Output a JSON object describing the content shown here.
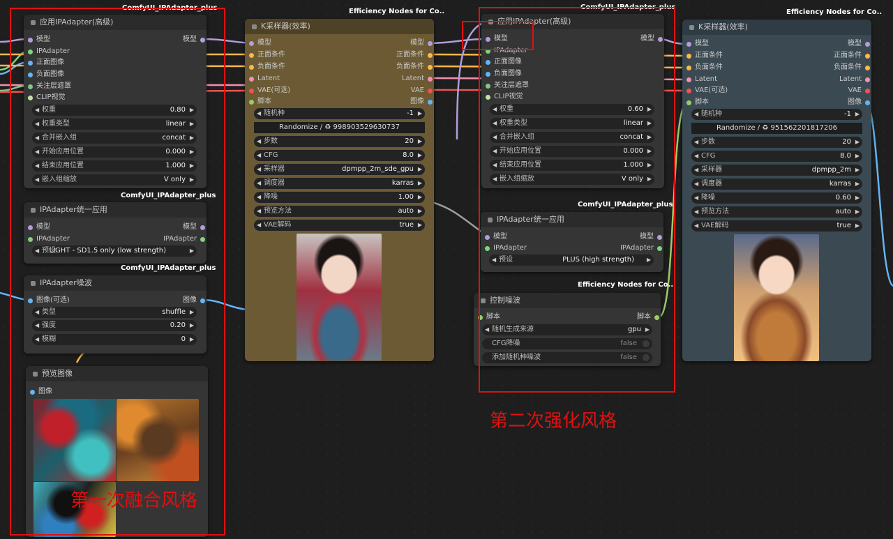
{
  "colors": {
    "model": "#b39ddb",
    "ipadapter": "#7cd67c",
    "image": "#64b5f6",
    "cond": "#ffb74d",
    "latent": "#f48fb1",
    "vae": "#ef5350",
    "mask": "#81c784",
    "clip": "#ffd54f",
    "script": "#9ccc65"
  },
  "n1": {
    "badge": "ComfyUI_IPAdapter_plus",
    "title": "应用IPAdapter(高级)",
    "inputs": [
      "模型",
      "IPAdapter",
      "正面图像",
      "负面图像",
      "关注层遮罩",
      "CLIP视觉"
    ],
    "out": "模型",
    "widgets": [
      {
        "label": "权重",
        "value": "0.80"
      },
      {
        "label": "权重类型",
        "value": "linear"
      },
      {
        "label": "合并嵌入组",
        "value": "concat"
      },
      {
        "label": "开始应用位置",
        "value": "0.000"
      },
      {
        "label": "结束应用位置",
        "value": "1.000"
      },
      {
        "label": "嵌入组缩放",
        "value": "V only"
      }
    ]
  },
  "n2": {
    "badge": "ComfyUI_IPAdapter_plus",
    "title": "IPAdapter统一应用",
    "inputs": [
      "模型",
      "IPAdapter"
    ],
    "outputs": [
      "模型",
      "IPAdapter"
    ],
    "widget": {
      "label": "预设",
      "value": "LIGHT - SD1.5 only (low strength)"
    }
  },
  "n3": {
    "badge": "ComfyUI_IPAdapter_plus",
    "title": "IPAdapter噪波",
    "input": "图像(可选)",
    "out": "图像",
    "widgets": [
      {
        "label": "类型",
        "value": "shuffle"
      },
      {
        "label": "强度",
        "value": "0.20"
      },
      {
        "label": "模糊",
        "value": "0"
      }
    ]
  },
  "n4": {
    "title": "预览图像",
    "input": "图像"
  },
  "n5": {
    "badge": "Efficiency Nodes for Co..",
    "title": "K采样器(效率)",
    "inputs": [
      "模型",
      "正面条件",
      "负面条件",
      "Latent",
      "VAE(可选)",
      "脚本"
    ],
    "outputs": [
      "模型",
      "正面条件",
      "负面条件",
      "Latent",
      "VAE",
      "图像"
    ],
    "seed": {
      "label": "随机种",
      "value": "-1"
    },
    "randomize": "Randomize / ♻ 998903529630737",
    "widgets": [
      {
        "label": "步数",
        "value": "20"
      },
      {
        "label": "CFG",
        "value": "8.0"
      },
      {
        "label": "采样器",
        "value": "dpmpp_2m_sde_gpu"
      },
      {
        "label": "调度器",
        "value": "karras"
      },
      {
        "label": "降噪",
        "value": "1.00"
      },
      {
        "label": "预览方法",
        "value": "auto"
      },
      {
        "label": "VAE解码",
        "value": "true"
      }
    ]
  },
  "n6": {
    "badge": "ComfyUI_IPAdapter_plus",
    "title": "应用IPAdapter(高级)",
    "inputs": [
      "模型",
      "IPAdapter",
      "正面图像",
      "负面图像",
      "关注层遮罩",
      "CLIP视觉"
    ],
    "out": "模型",
    "widgets": [
      {
        "label": "权重",
        "value": "0.60"
      },
      {
        "label": "权重类型",
        "value": "linear"
      },
      {
        "label": "合并嵌入组",
        "value": "concat"
      },
      {
        "label": "开始应用位置",
        "value": "0.000"
      },
      {
        "label": "结束应用位置",
        "value": "1.000"
      },
      {
        "label": "嵌入组缩放",
        "value": "V only"
      }
    ]
  },
  "n7": {
    "badge": "ComfyUI_IPAdapter_plus",
    "title": "IPAdapter统一应用",
    "inputs": [
      "模型",
      "IPAdapter"
    ],
    "outputs": [
      "模型",
      "IPAdapter"
    ],
    "widget": {
      "label": "预设",
      "value": "PLUS (high strength)"
    }
  },
  "n8": {
    "badge": "Efficiency Nodes for Co..",
    "title": "控制噪波",
    "input": "脚本",
    "out": "脚本",
    "widgets": [
      {
        "label": "随机生成来源",
        "value": "gpu"
      }
    ],
    "toggles": [
      {
        "label": "CFG降噪",
        "value": "false"
      },
      {
        "label": "添加随机种噪波",
        "value": "false"
      }
    ]
  },
  "n9": {
    "badge": "Efficiency Nodes for Co..",
    "title": "K采样器(效率)",
    "inputs": [
      "模型",
      "正面条件",
      "负面条件",
      "Latent",
      "VAE(可选)",
      "脚本"
    ],
    "outputs": [
      "模型",
      "正面条件",
      "负面条件",
      "Latent",
      "VAE",
      "图像"
    ],
    "seed": {
      "label": "随机种",
      "value": "-1"
    },
    "randomize": "Randomize / ♻ 951562201817206",
    "widgets": [
      {
        "label": "步数",
        "value": "20"
      },
      {
        "label": "CFG",
        "value": "8.0"
      },
      {
        "label": "采样器",
        "value": "dpmpp_2m"
      },
      {
        "label": "调度器",
        "value": "karras"
      },
      {
        "label": "降噪",
        "value": "0.60"
      },
      {
        "label": "预览方法",
        "value": "auto"
      },
      {
        "label": "VAE解码",
        "value": "true"
      }
    ]
  },
  "annotations": {
    "second": "第二次强化风格",
    "first": "第一次融合风格"
  }
}
